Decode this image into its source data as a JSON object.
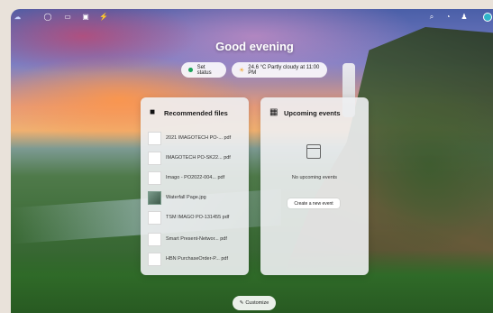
{
  "greeting": "Good evening",
  "status": {
    "label": "Set status",
    "color": "#1aa35a"
  },
  "weather": {
    "icon": "partly-cloudy-icon",
    "text": "24.6 °C Partly cloudy at 11:00 PM"
  },
  "recommended": {
    "title": "Recommended files",
    "files": [
      {
        "name": "2021 IMAGOTECH PO-...",
        "ext": "pdf",
        "kind": "doc"
      },
      {
        "name": "IMAGOTECH PO-SK22...",
        "ext": "pdf",
        "kind": "doc"
      },
      {
        "name": "Imago - PO2022-004...",
        "ext": "pdf",
        "kind": "doc"
      },
      {
        "name": "Waterfall Page",
        "ext": "jpg",
        "kind": "image"
      },
      {
        "name": "TSM IMAGO PO-131455",
        "ext": "pdf",
        "kind": "doc"
      },
      {
        "name": "Smart Present-Networ...",
        "ext": "pdf",
        "kind": "doc"
      },
      {
        "name": "HBN PurchaseOrder-P...",
        "ext": "pdf",
        "kind": "doc"
      }
    ]
  },
  "events": {
    "title": "Upcoming events",
    "empty_text": "No upcoming events",
    "create_label": "Create a new event"
  },
  "customize_label": "Customize"
}
